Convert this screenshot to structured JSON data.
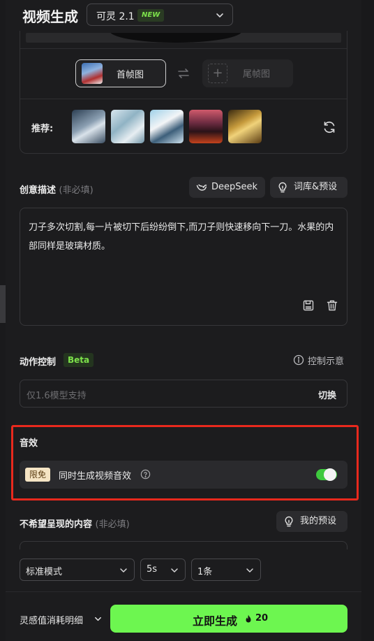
{
  "header": {
    "title": "视频生成",
    "model_name": "可灵 2.1",
    "model_badge": "NEW"
  },
  "frames": {
    "first_label": "首帧图",
    "last_label": "尾帧图"
  },
  "recommend": {
    "label": "推荐:"
  },
  "description": {
    "label": "创意描述",
    "optional": "(非必填)",
    "deepseek_label": "DeepSeek",
    "library_label": "词库&预设",
    "text": "刀子多次切割,每一片被切下后纷纷倒下,而刀子则快速移向下一刀。水果的内部同样是玻璃材质。"
  },
  "motion": {
    "label": "动作控制",
    "badge": "Beta",
    "info_label": "控制示意",
    "placeholder": "仅1.6模型支持",
    "switch_label": "切换"
  },
  "sound": {
    "label": "音效",
    "free_tag": "限免",
    "option_label": "同时生成视频音效",
    "enabled": true
  },
  "negative": {
    "label": "不希望呈现的内容",
    "optional": "(非必填)",
    "preset_label": "我的预设"
  },
  "options": {
    "mode": "标准模式",
    "duration": "5s",
    "count": "1条"
  },
  "footer": {
    "consume_label": "灵感值消耗明细",
    "generate_label": "立即生成",
    "cost": "20"
  },
  "colors": {
    "accent_green": "#6df650",
    "highlight_red": "#e8291d",
    "toggle_on": "#3ec93e"
  }
}
